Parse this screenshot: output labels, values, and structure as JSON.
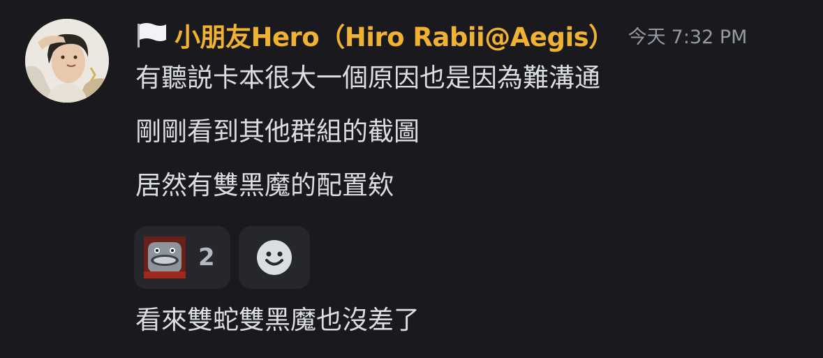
{
  "message_header": {
    "username": "小朋友Hero（Hiro Rabii@Aegis）",
    "timestamp_day": "今天",
    "timestamp_time": "7:32 PM"
  },
  "messages": [
    "有聽説卡本很大一個原因也是因為難溝通",
    "剛剛看到其他群組的截圖",
    "居然有雙黑魔的配置欸",
    "看來雙蛇雙黑魔也沒差了"
  ],
  "reactions": [
    {
      "emoji_icon": "custom-face-emoji-icon",
      "count": "2"
    }
  ],
  "add_reaction_icon": "smiley-face-icon",
  "colors": {
    "background": "#1a1a1e",
    "username": "#f0b232",
    "message_text": "#dbdee1",
    "timestamp": "#949ba4",
    "reaction_bg": "#26272c"
  }
}
